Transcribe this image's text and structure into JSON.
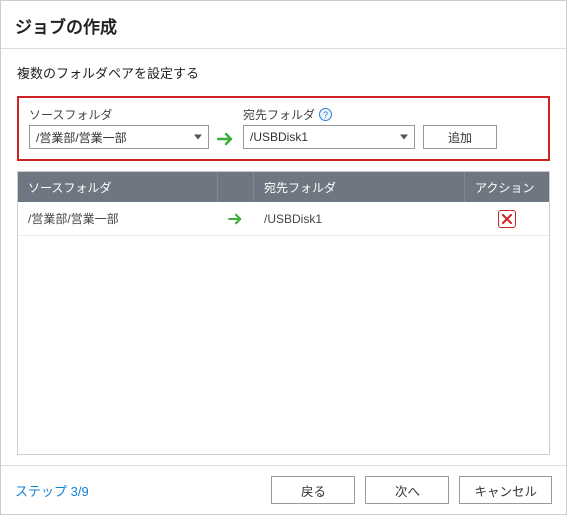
{
  "title": "ジョブの作成",
  "subtitle": "複数のフォルダペアを設定する",
  "pair_editor": {
    "source_label": "ソースフォルダ",
    "dest_label": "宛先フォルダ",
    "source_value": "/営業部/営業一部",
    "dest_value": "/USBDisk1",
    "add_label": "追加"
  },
  "table": {
    "headers": {
      "source": "ソースフォルダ",
      "dest": "宛先フォルダ",
      "action": "アクション"
    },
    "rows": [
      {
        "source": "/営業部/営業一部",
        "dest": "/USBDisk1"
      }
    ]
  },
  "footer": {
    "step_text": "ステップ 3/9",
    "back": "戻る",
    "next": "次へ",
    "cancel": "キャンセル"
  }
}
